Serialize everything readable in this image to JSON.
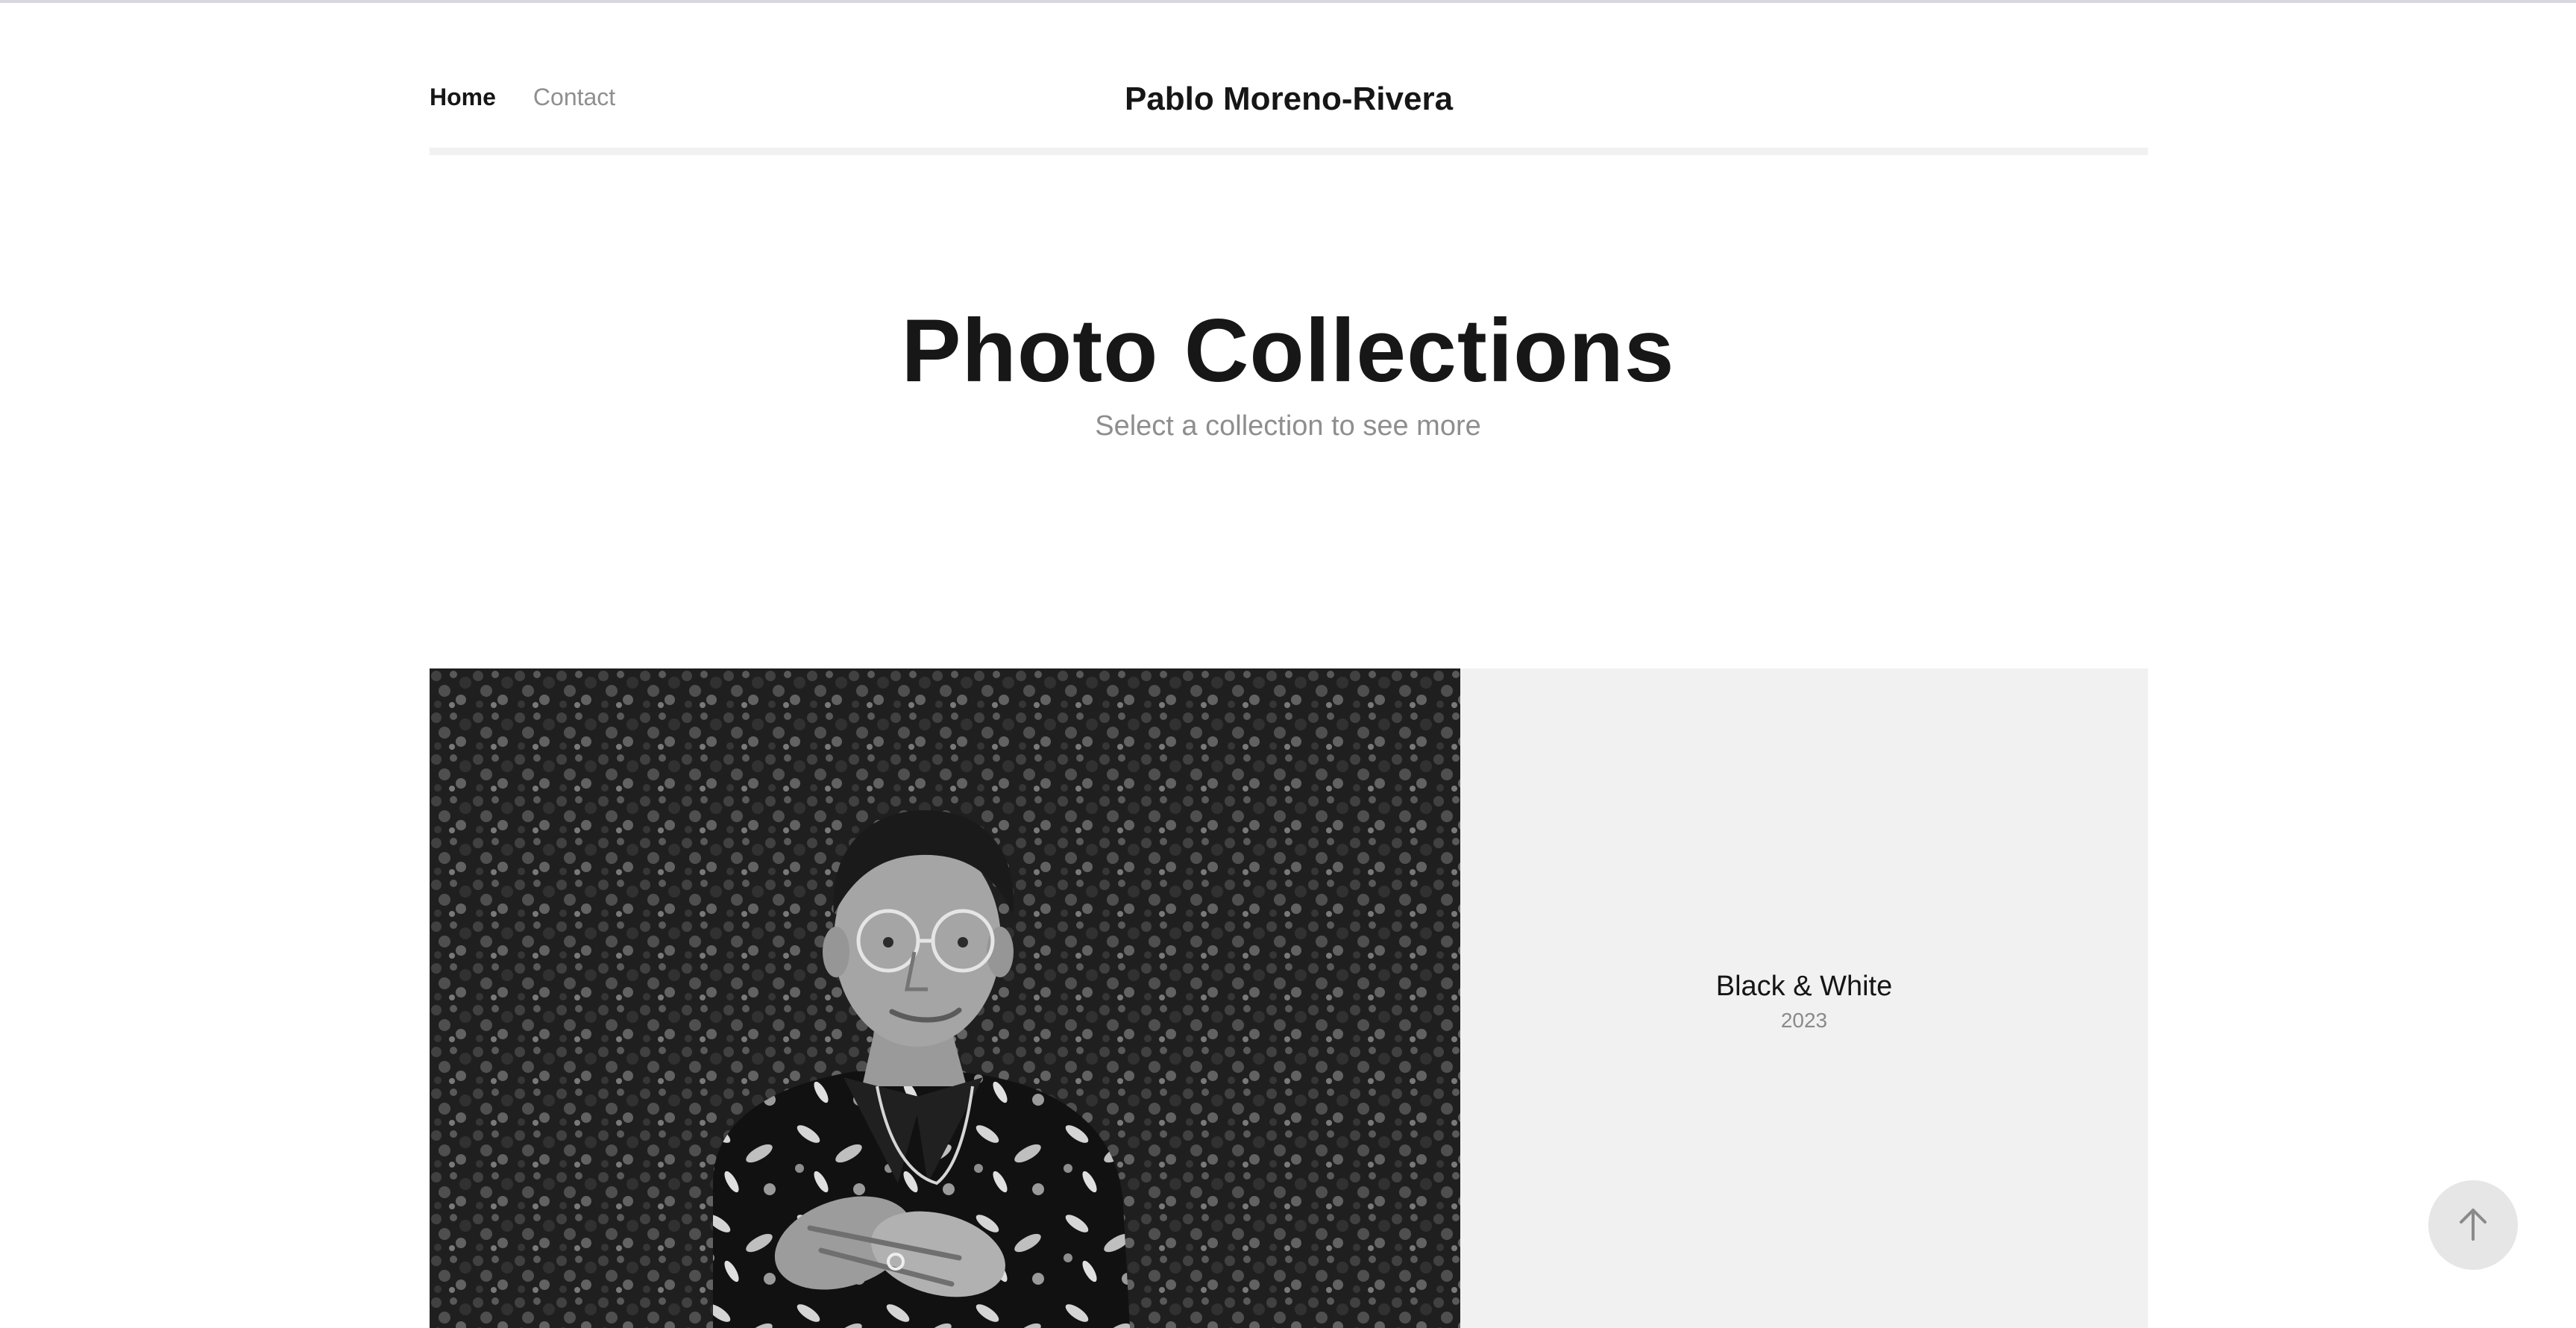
{
  "header": {
    "nav": [
      {
        "label": "Home",
        "active": true
      },
      {
        "label": "Contact",
        "active": false
      }
    ],
    "site_name": "Pablo Moreno-Rivera"
  },
  "hero": {
    "title": "Photo Collections",
    "subtitle": "Select a collection to see more"
  },
  "collections": [
    {
      "title": "Black & White",
      "year": "2023"
    }
  ],
  "icons": {
    "back_to_top": "arrow-up-icon"
  },
  "colors": {
    "text": "#161616",
    "muted": "#8f8f8f",
    "panel": "#f1f1f1",
    "button": "#e6e6e6"
  }
}
